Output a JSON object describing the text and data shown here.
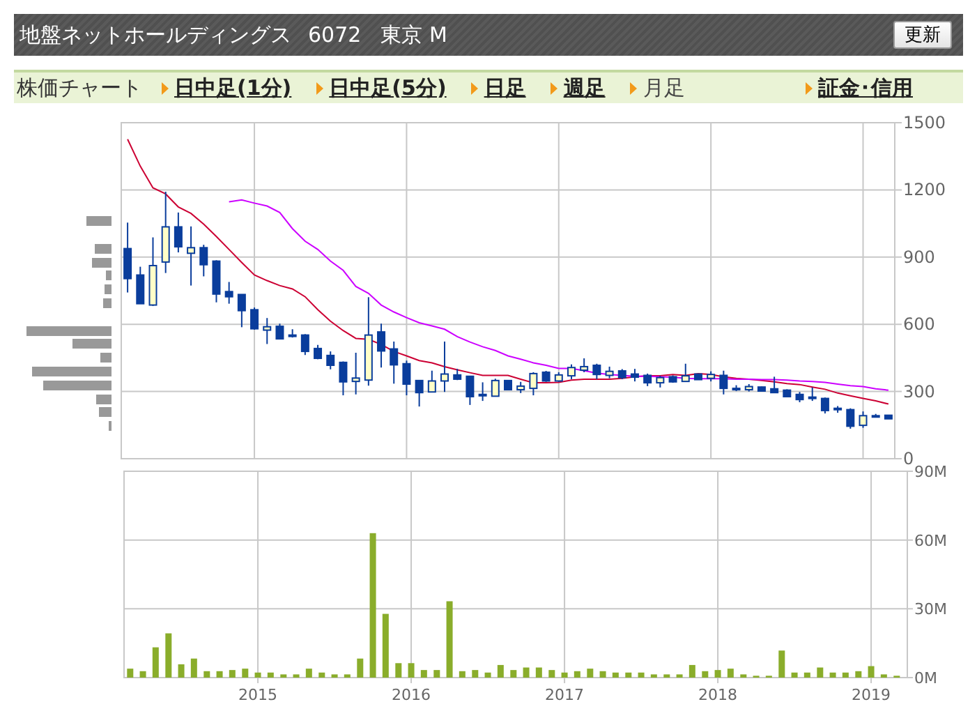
{
  "header": {
    "company": "地盤ネットホールディングス",
    "code": "6072",
    "market": "東京 M",
    "button": "更新"
  },
  "nav": {
    "label": "株価チャート",
    "tabs": [
      {
        "label": "日中足(1分)",
        "selected": false
      },
      {
        "label": "日中足(5分)",
        "selected": false
      },
      {
        "label": "日足",
        "selected": false
      },
      {
        "label": "週足",
        "selected": false
      },
      {
        "label": "月足",
        "selected": true
      }
    ],
    "link": "証金･信用"
  },
  "price_chart": {
    "chart_data": {
      "type": "candlestick",
      "grid": true,
      "ylim": [
        0,
        1500
      ],
      "yticks": [
        0,
        300,
        600,
        900,
        1200,
        1500
      ],
      "categories": [
        null,
        null,
        null,
        null,
        null,
        null,
        null,
        null,
        null,
        null,
        null,
        null,
        null,
        null,
        null,
        null,
        null,
        null,
        null,
        null,
        null,
        null,
        null,
        null,
        null,
        null,
        null,
        null,
        null,
        null,
        null,
        null,
        null,
        null,
        null,
        null,
        null,
        null,
        null,
        null,
        null,
        null,
        null,
        null,
        null,
        null,
        null,
        null,
        null,
        null,
        null,
        null,
        null,
        null,
        null,
        null,
        null,
        null,
        null,
        null,
        null
      ],
      "ohlc": [
        [
          938,
          1054,
          742,
          804
        ],
        [
          820,
          857,
          692,
          692
        ],
        [
          686,
          988,
          682,
          862
        ],
        [
          878,
          1192,
          829,
          1035
        ],
        [
          1035,
          1099,
          921,
          946
        ],
        [
          917,
          1037,
          773,
          942
        ],
        [
          942,
          955,
          814,
          866
        ],
        [
          882,
          886,
          698,
          735
        ],
        [
          746,
          789,
          692,
          723
        ],
        [
          733,
          733,
          587,
          661
        ],
        [
          665,
          675,
          576,
          580
        ],
        [
          574,
          628,
          512,
          589
        ],
        [
          591,
          603,
          535,
          535
        ],
        [
          552,
          578,
          541,
          550
        ],
        [
          552,
          556,
          463,
          479
        ],
        [
          492,
          508,
          444,
          448
        ],
        [
          461,
          479,
          399,
          417
        ],
        [
          430,
          434,
          283,
          343
        ],
        [
          345,
          473,
          287,
          360
        ],
        [
          351,
          721,
          326,
          552
        ],
        [
          566,
          603,
          407,
          481
        ],
        [
          490,
          523,
          335,
          419
        ],
        [
          424,
          438,
          283,
          333
        ],
        [
          349,
          349,
          233,
          295
        ],
        [
          298,
          393,
          298,
          347
        ],
        [
          347,
          523,
          298,
          378
        ],
        [
          374,
          401,
          351,
          355
        ],
        [
          368,
          368,
          240,
          277
        ],
        [
          287,
          341,
          258,
          285
        ],
        [
          279,
          357,
          279,
          349
        ],
        [
          349,
          349,
          308,
          308
        ],
        [
          308,
          343,
          293,
          324
        ],
        [
          314,
          386,
          283,
          380
        ],
        [
          386,
          392,
          343,
          347
        ],
        [
          347,
          386,
          343,
          374
        ],
        [
          370,
          421,
          355,
          407
        ],
        [
          395,
          448,
          386,
          411
        ],
        [
          417,
          424,
          355,
          376
        ],
        [
          372,
          411,
          359,
          390
        ],
        [
          392,
          400,
          355,
          362
        ],
        [
          378,
          401,
          345,
          364
        ],
        [
          372,
          380,
          324,
          339
        ],
        [
          339,
          370,
          318,
          362
        ],
        [
          366,
          372,
          339,
          343
        ],
        [
          345,
          424,
          345,
          370
        ],
        [
          378,
          380,
          353,
          353
        ],
        [
          359,
          390,
          345,
          376
        ],
        [
          372,
          393,
          287,
          314
        ],
        [
          312,
          328,
          302,
          314
        ],
        [
          308,
          333,
          300,
          322
        ],
        [
          320,
          322,
          302,
          302
        ],
        [
          312,
          366,
          295,
          295
        ],
        [
          306,
          310,
          277,
          277
        ],
        [
          287,
          298,
          252,
          264
        ],
        [
          275,
          318,
          258,
          273
        ],
        [
          269,
          273,
          202,
          215
        ],
        [
          225,
          235,
          205,
          223
        ],
        [
          219,
          225,
          134,
          145
        ],
        [
          149,
          211,
          138,
          192
        ],
        [
          192,
          200,
          186,
          190
        ],
        [
          194,
          196,
          178,
          178
        ]
      ],
      "series": [
        {
          "type": "line",
          "color": "#cc0033",
          "values": [
            1426,
            1306,
            1209,
            1182,
            1124,
            1095,
            1047,
            992,
            934,
            876,
            820,
            795,
            773,
            758,
            723,
            665,
            614,
            572,
            537,
            533,
            510,
            479,
            459,
            438,
            428,
            411,
            397,
            384,
            372,
            372,
            372,
            355,
            339,
            339,
            341,
            351,
            355,
            355,
            355,
            359,
            366,
            370,
            370,
            376,
            372,
            380,
            376,
            366,
            359,
            355,
            349,
            343,
            335,
            331,
            320,
            310,
            293,
            281,
            269,
            258,
            244
          ]
        },
        {
          "type": "line",
          "color": "#cc00ff",
          "values": [
            null,
            null,
            null,
            null,
            null,
            null,
            null,
            null,
            1147,
            1155,
            1141,
            1128,
            1099,
            1027,
            971,
            934,
            882,
            841,
            769,
            738,
            686,
            655,
            630,
            607,
            593,
            578,
            545,
            521,
            500,
            483,
            459,
            444,
            428,
            417,
            403,
            403,
            393,
            382,
            376,
            372,
            368,
            368,
            366,
            364,
            359,
            357,
            357,
            357,
            355,
            355,
            353,
            353,
            351,
            347,
            345,
            341,
            333,
            326,
            322,
            312,
            306
          ]
        }
      ]
    }
  },
  "volume_chart": {
    "chart_data": {
      "type": "bar",
      "grid": true,
      "xlim": [
        2014.127,
        2019.236
      ],
      "ylim": [
        0,
        90
      ],
      "yticks": [
        {
          "value": 0,
          "label": "0M"
        },
        {
          "value": 30,
          "label": "30M"
        },
        {
          "value": 60,
          "label": "60M"
        },
        {
          "value": 90,
          "label": "90M"
        }
      ],
      "xticks": [
        2015,
        2016,
        2017,
        2018,
        2019
      ],
      "x": [
        2014.167,
        2014.25,
        2014.333,
        2014.417,
        2014.5,
        2014.583,
        2014.667,
        2014.75,
        2014.833,
        2014.917,
        2015,
        2015.083,
        2015.167,
        2015.25,
        2015.333,
        2015.417,
        2015.5,
        2015.583,
        2015.667,
        2015.75,
        2015.833,
        2015.917,
        2016,
        2016.083,
        2016.167,
        2016.25,
        2016.333,
        2016.417,
        2016.5,
        2016.583,
        2016.667,
        2016.75,
        2016.833,
        2016.917,
        2017,
        2017.083,
        2017.167,
        2017.25,
        2017.333,
        2017.417,
        2017.5,
        2017.583,
        2017.667,
        2017.75,
        2017.833,
        2017.917,
        2018,
        2018.083,
        2018.167,
        2018.25,
        2018.333,
        2018.417,
        2018.5,
        2018.583,
        2018.667,
        2018.75,
        2018.833,
        2018.917,
        2019,
        2019.083,
        2019.167
      ],
      "series": [
        {
          "color": "#8aad2b",
          "values": [
            3.9,
            2.8,
            13.2,
            19.3,
            5.8,
            8.3,
            2.8,
            2.8,
            3.3,
            3.9,
            2.2,
            2.2,
            1.4,
            1.4,
            3.9,
            2.2,
            1.4,
            1.4,
            8.3,
            63,
            27.8,
            6.3,
            6.3,
            3.3,
            3.3,
            33.3,
            2.8,
            3.3,
            2.2,
            5.5,
            3.3,
            4.4,
            4.4,
            3.3,
            2.2,
            2.8,
            3.9,
            2.8,
            2.2,
            2.2,
            2.2,
            1.4,
            1.4,
            1.4,
            5.5,
            2.8,
            3.3,
            3.9,
            1.4,
            0.8,
            0.8,
            11.8,
            2.2,
            2.2,
            4.4,
            2.2,
            2.2,
            2.8,
            5.0,
            1.4,
            0.8
          ]
        }
      ]
    }
  }
}
